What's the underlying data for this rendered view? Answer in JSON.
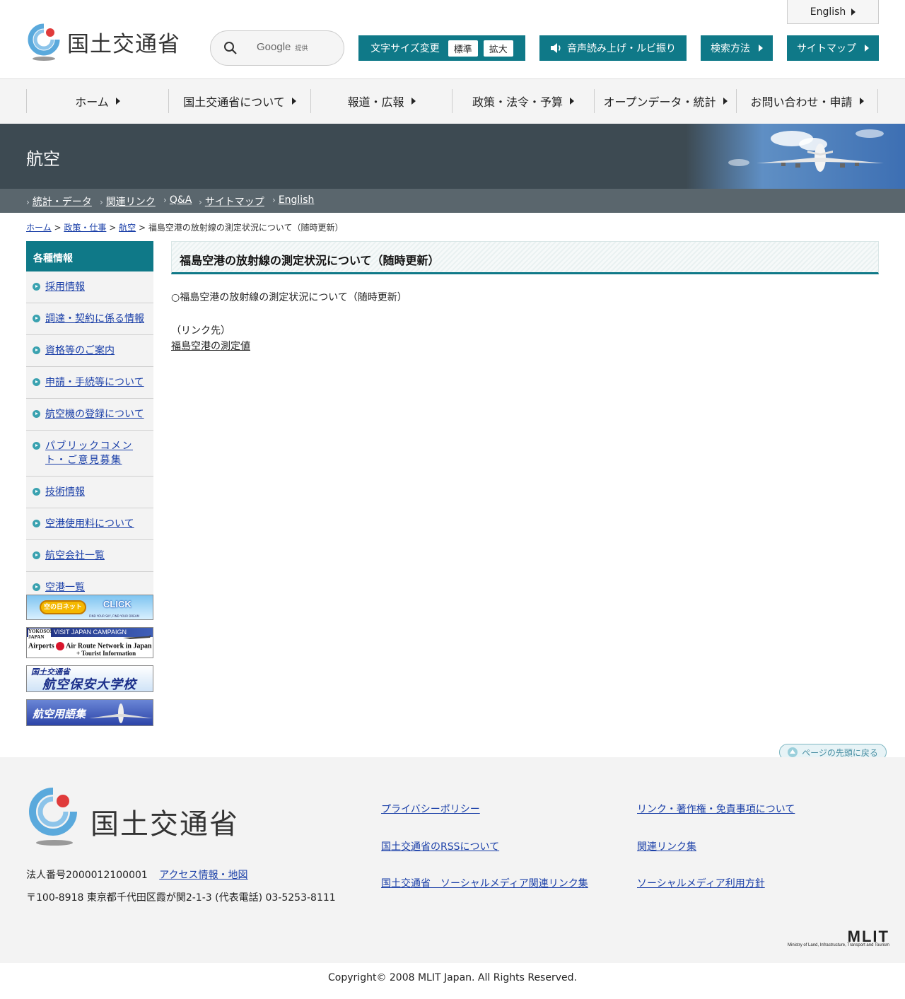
{
  "header": {
    "logo_text": "国土交通省",
    "search_provider": "Google",
    "search_provider_suffix": "提供",
    "english_label": "English",
    "font_size_label": "文字サイズ変更",
    "font_size_standard": "標準",
    "font_size_large": "拡大",
    "speech_label": "音声読み上げ・ルビ振り",
    "search_method_label": "検索方法",
    "sitemap_label": "サイトマップ"
  },
  "gnav": {
    "items": [
      "ホーム",
      "国土交通省について",
      "報道・広報",
      "政策・法令・予算",
      "オープンデータ・統計",
      "お問い合わせ・申請"
    ]
  },
  "banner": {
    "title": "航空"
  },
  "subnav": {
    "items": [
      "統計・データ",
      "関連リンク",
      "Q&A",
      "サイトマップ",
      "English"
    ]
  },
  "breadcrumb": {
    "items": [
      "ホーム",
      "政策・仕事",
      "航空"
    ],
    "current": "福島空港の放射線の測定状況について（随時更新）"
  },
  "side": {
    "heading": "各種情報",
    "items": [
      "採用情報",
      "調達・契約に係る情報",
      "資格等のご案内",
      "申請・手続等について",
      "航空機の登録について",
      "パブリックコメント・ご意見募集",
      "技術情報",
      "空港使用料について",
      "航空会社一覧",
      "空港一覧"
    ],
    "banners": {
      "sora_logo": "空の日ネット",
      "sora_click": "CLICK",
      "sora_tagline": "FIND YOUR SKY, FIND YOUR DREAM",
      "vj_campaign": "VISIT JAPAN CAMPAIGN",
      "vj_yokoso": "YOKOSO! JAPAN",
      "vj_line1": "Airports",
      "vj_line1b": "Air Route Network in Japan",
      "vj_line2": "+ Tourist Information",
      "school_line1": "国土交通省",
      "school_line2": "航空保安大学校",
      "glossary": "航空用語集"
    }
  },
  "main": {
    "title": "福島空港の放射線の測定状況について（随時更新）",
    "paragraph": "○福島空港の放射線の測定状況について（随時更新）",
    "link_caption": "（リンク先）",
    "link_text": "福島空港の測定値"
  },
  "to_top": "ページの先頭に戻る",
  "footer": {
    "logo_text": "国土交通省",
    "corp_number": "法人番号2000012100001",
    "access_link": "アクセス情報・地図",
    "address": "〒100-8918 東京都千代田区霞が関2-1-3 (代表電話) 03-5253-8111",
    "links": [
      "プライバシーポリシー",
      "リンク・著作権・免責事項について",
      "国土交通省のRSSについて",
      "関連リンク集",
      "国土交通省　ソーシャルメディア関連リンク集",
      "ソーシャルメディア利用方針"
    ],
    "mlit_logo": "MLIT",
    "mlit_subtitle": "Ministry of Land, Infrastructure, Transport and Tourism",
    "copyright": "Copyright© 2008 MLIT Japan. All Rights Reserved."
  },
  "colors": {
    "teal": "#0f7988",
    "banner_dark": "#3d4a52",
    "subnav": "#5a666d",
    "link": "#1a3fa8"
  }
}
